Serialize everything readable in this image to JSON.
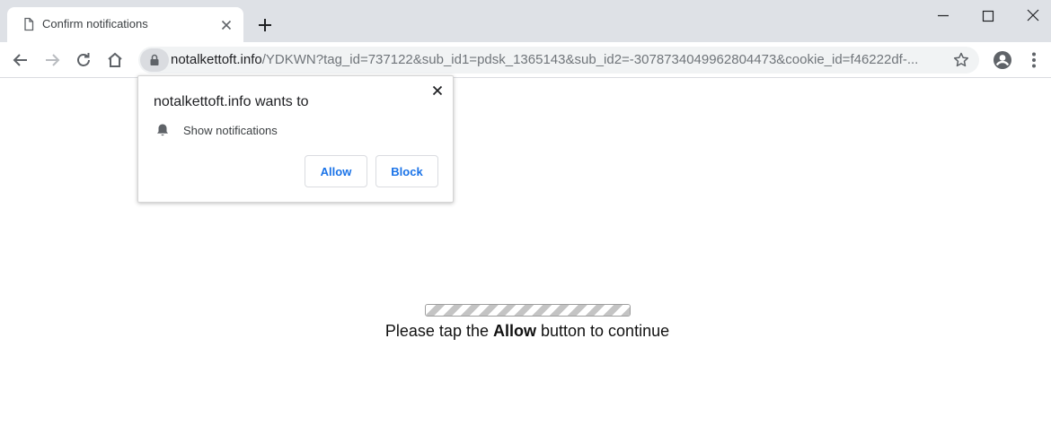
{
  "tab": {
    "title": "Confirm notifications"
  },
  "address_bar": {
    "host": "notalkettoft.info",
    "path": "/YDKWN?tag_id=737122&sub_id1=pdsk_1365143&sub_id2=-3078734049962804473&cookie_id=f46222df-..."
  },
  "permission_prompt": {
    "title": "notalkettoft.info wants to",
    "permission": "Show notifications",
    "allow_label": "Allow",
    "block_label": "Block"
  },
  "page": {
    "progress": 1.0,
    "cta_before": "Please tap the ",
    "cta_bold": "Allow",
    "cta_after": " button to continue"
  },
  "icons": {
    "favicon": "document-icon",
    "tab_close": "close-icon",
    "new_tab": "plus-icon",
    "back": "arrow-left-icon",
    "forward": "arrow-right-icon",
    "reload": "reload-icon",
    "home": "home-icon",
    "secure": "lock-icon",
    "bookmark": "star-icon",
    "profile": "account-icon",
    "menu": "kebab-menu-icon",
    "notification": "bell-icon"
  },
  "colors": {
    "accent": "#1a73e8",
    "tabstrip": "#dee1e6"
  }
}
